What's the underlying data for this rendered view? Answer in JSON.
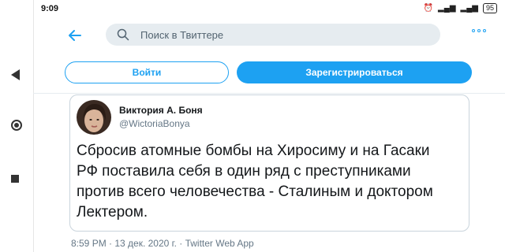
{
  "status_bar": {
    "time": "9:09",
    "battery": "95"
  },
  "search": {
    "placeholder": "Поиск в Твиттере"
  },
  "buttons": {
    "login": "Войти",
    "signup": "Зарегистрироваться"
  },
  "tweet": {
    "author_name": "Виктория А. Боня",
    "author_handle": "@WictoriaBonya",
    "text_lines": [
      "Сбросив атомные бомбы на Хиросиму и на Гасаки",
      "РФ поставила себя в один ряд с преступниками",
      "против всего человечества - Сталиным и доктором",
      "Лектером."
    ],
    "timestamp": "8:59 PM · 13 дек. 2020 г. · Twitter Web App"
  },
  "colors": {
    "accent": "#1da1f2",
    "search_bg": "#e6ecf0",
    "muted_text": "#657786"
  },
  "icons": {
    "nav_back": "triangle-back-icon",
    "nav_home": "circle-home-icon",
    "nav_recent": "square-recent-icon",
    "header_back": "arrow-left-icon",
    "search": "search-icon",
    "more": "more-dots-icon"
  }
}
